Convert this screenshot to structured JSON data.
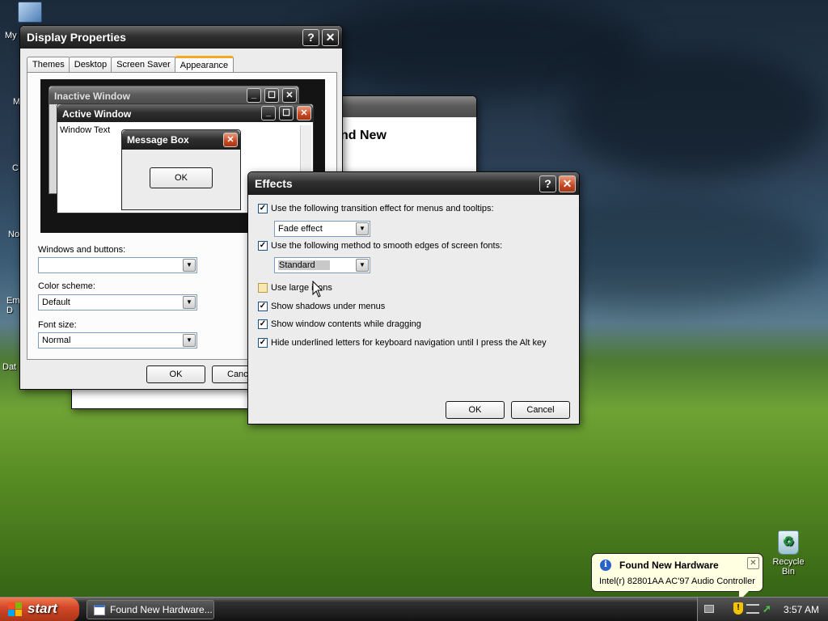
{
  "desktop": {
    "icons_left": [
      "My",
      "M",
      "C",
      "No",
      "Em\nD",
      "Dat"
    ],
    "recycle_bin_label": "Recycle Bin"
  },
  "display_properties": {
    "title": "Display Properties",
    "tabs": [
      {
        "label": "Themes",
        "active": false
      },
      {
        "label": "Desktop",
        "active": false
      },
      {
        "label": "Screen Saver",
        "active": false
      },
      {
        "label": "Appearance",
        "active": true
      }
    ],
    "preview": {
      "inactive_title": "Inactive Window",
      "active_title": "Active Window",
      "window_text": "Window Text",
      "message_box_title": "Message Box",
      "message_box_ok": "OK"
    },
    "windows_buttons_label": "Windows and buttons:",
    "windows_buttons_value": "",
    "color_scheme_label": "Color scheme:",
    "color_scheme_value": "Default",
    "font_size_label": "Font size:",
    "font_size_value": "Normal",
    "ok_label": "OK",
    "cancel_label": "Canc"
  },
  "background_window": {
    "title_fragment": "nd New"
  },
  "effects": {
    "title": "Effects",
    "transition": {
      "label": "Use the following transition effect for menus and tooltips:",
      "checked": true,
      "value": "Fade effect"
    },
    "smoothing": {
      "label": "Use the following method to smooth edges of screen fonts:",
      "checked": true,
      "value": "Standard"
    },
    "options": [
      {
        "label": "Use large icons",
        "checked": false
      },
      {
        "label": "Show shadows under menus",
        "checked": true
      },
      {
        "label": "Show window contents while dragging",
        "checked": true
      },
      {
        "label": "Hide underlined letters for keyboard navigation until I press the Alt key",
        "checked": true
      }
    ],
    "ok_label": "OK",
    "cancel_label": "Cancel"
  },
  "balloon": {
    "title": "Found New Hardware",
    "message": "Intel(r) 82801AA AC'97 Audio Controller"
  },
  "taskbar": {
    "start_label": "start",
    "task_item": "Found New Hardware...",
    "clock": "3:57 AM"
  },
  "icons": {
    "help": "?",
    "close": "✕",
    "minimize": "_",
    "maximize": "☐",
    "dropdown": "▼",
    "check": "✓",
    "info": "i"
  }
}
